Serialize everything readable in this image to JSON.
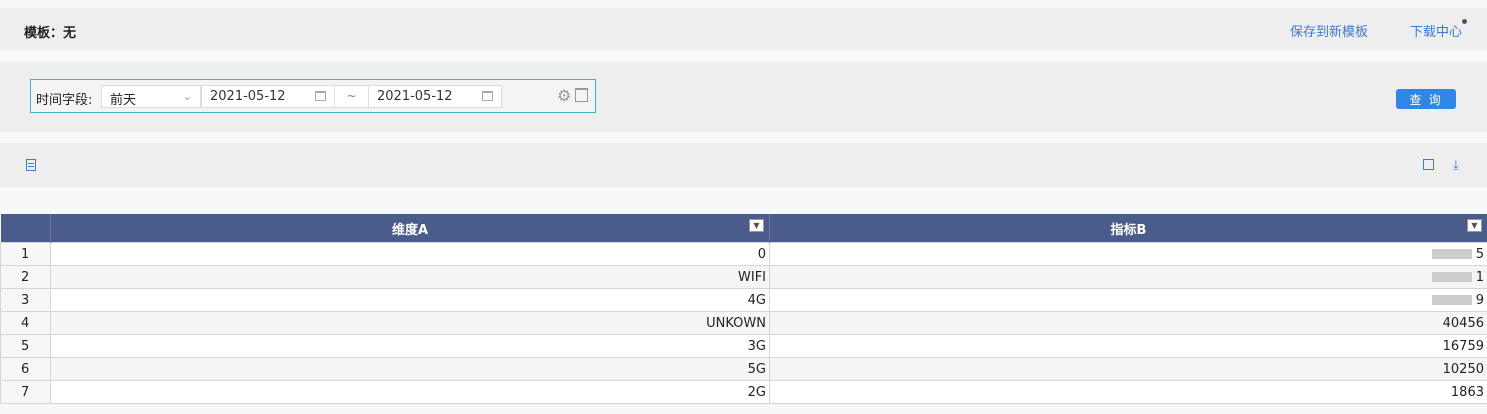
{
  "header": {
    "template_label": "模板：无",
    "save_link": "保存到新模板",
    "download_link": "下载中心"
  },
  "filter": {
    "label": "时间字段:",
    "preset": "前天",
    "start_date": "2021-05-12",
    "separator": "~",
    "end_date": "2021-05-12",
    "query_button": "查 询"
  },
  "table": {
    "columns": [
      "维度A",
      "指标B"
    ],
    "rows": [
      {
        "index": "1",
        "dim": "0",
        "metric": "5"
      },
      {
        "index": "2",
        "dim": "WIFI",
        "metric": "1"
      },
      {
        "index": "3",
        "dim": "4G",
        "metric": "9"
      },
      {
        "index": "4",
        "dim": "UNKOWN",
        "metric": "40456"
      },
      {
        "index": "5",
        "dim": "3G",
        "metric": "16759"
      },
      {
        "index": "6",
        "dim": "5G",
        "metric": "10250"
      },
      {
        "index": "7",
        "dim": "2G",
        "metric": "1863"
      }
    ]
  },
  "colors": {
    "accent": "#3a7bd5",
    "header_bg": "#4a5c8c",
    "button_bg": "#2f86e6"
  }
}
